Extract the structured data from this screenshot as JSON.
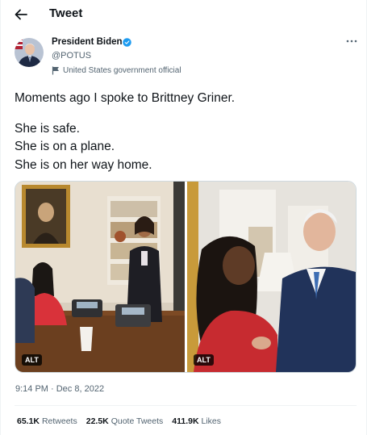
{
  "header": {
    "title": "Tweet"
  },
  "author": {
    "display_name": "President Biden",
    "handle": "@POTUS",
    "label": "United States government official"
  },
  "tweet": {
    "line1": "Moments ago I spoke to Brittney Griner.",
    "line2": "She is safe.",
    "line3": "She is on a plane.",
    "line4": "She is on her way home."
  },
  "media": {
    "left_alt": "ALT",
    "right_alt": "ALT"
  },
  "timestamp": "9:14 PM · Dec 8, 2022",
  "stats": {
    "retweets_count": "65.1K",
    "retweets_label": "Retweets",
    "quotes_count": "22.5K",
    "quotes_label": "Quote Tweets",
    "likes_count": "411.9K",
    "likes_label": "Likes"
  },
  "colors": {
    "text_primary": "#0f1419",
    "text_secondary": "#536471",
    "verified_blue": "#1d9bf0",
    "divider": "#eff3f4"
  }
}
